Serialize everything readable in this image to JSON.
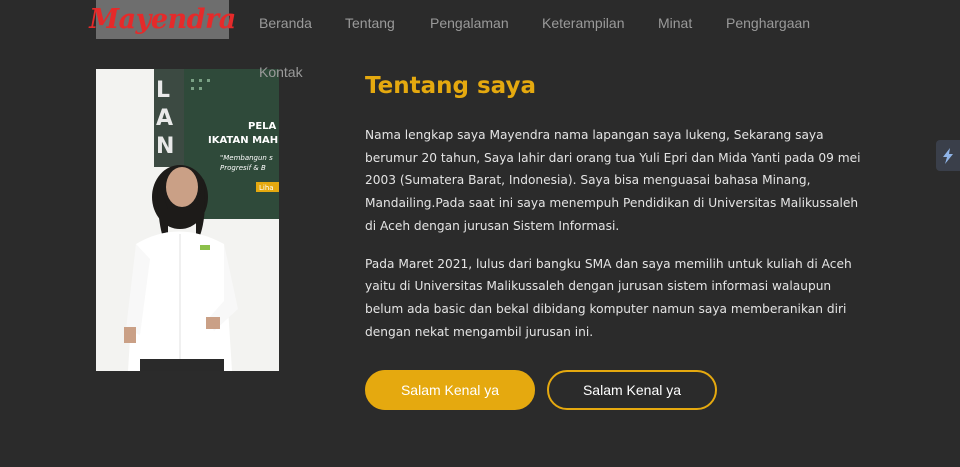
{
  "brand": {
    "logo_text": "Mayendra"
  },
  "nav": {
    "items": [
      {
        "label": "Beranda"
      },
      {
        "label": "Tentang"
      },
      {
        "label": "Pengalaman"
      },
      {
        "label": "Keterampilan"
      },
      {
        "label": "Minat"
      },
      {
        "label": "Penghargaan"
      },
      {
        "label": "Kontak"
      }
    ]
  },
  "photo": {
    "banner_lines": [
      "PELA",
      "IKATAN MAH",
      "\"Membangun s",
      "Progresif & B",
      "Liha"
    ],
    "side_letters": [
      "L",
      "A",
      "N"
    ]
  },
  "about": {
    "heading": "Tentang saya",
    "paragraph_1": "Nama lengkap saya Mayendra nama lapangan saya lukeng, Sekarang saya berumur 20 tahun, Saya lahir dari orang tua Yuli Epri dan Mida Yanti pada 09 mei 2003 (Sumatera Barat, Indonesia). Saya bisa menguasai bahasa Minang, Mandailing.Pada saat ini saya menempuh Pendidikan di Universitas Malikussaleh di Aceh dengan jurusan Sistem Informasi.",
    "paragraph_2": "Pada Maret 2021, lulus dari bangku SMA dan saya memilih untuk kuliah di Aceh yaitu di Universitas Malikussaleh dengan jurusan sistem informasi walaupun belum ada basic dan bekal dibidang komputer namun saya memberanikan diri dengan nekat mengambil jurusan ini."
  },
  "buttons": {
    "primary_label": "Salam Kenal ya",
    "secondary_label": "Salam Kenal ya"
  },
  "colors": {
    "accent": "#e5a90f",
    "background": "#2b2b2b",
    "logo": "#e52a2a"
  },
  "icons": {
    "side_tab": "lightning-icon"
  }
}
